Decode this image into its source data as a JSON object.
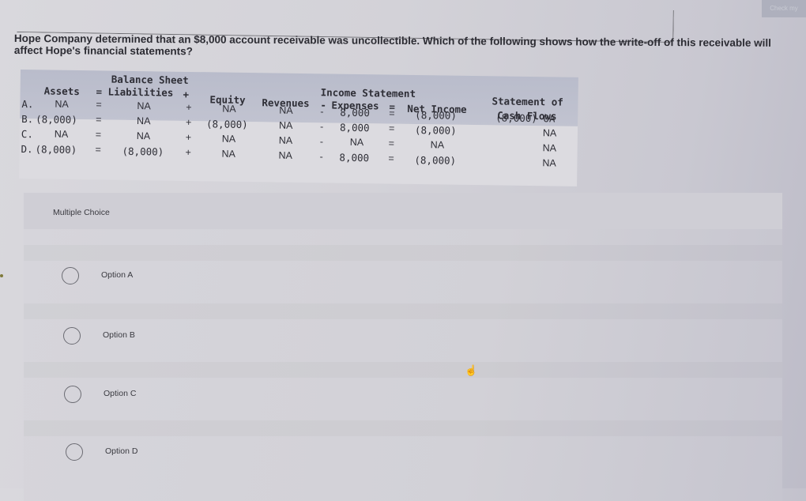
{
  "top_right_button": {
    "label": "Check my"
  },
  "question": {
    "text": "Hope Company determined that an $8,000 account receivable was uncollectible. Which of the following shows how the write-off of this receivable will affect Hope's financial statements?"
  },
  "financial_table": {
    "balance_sheet_title": "Balance Sheet",
    "income_statement_title": "Income Statement",
    "cash_flow_title_line1": "Statement of",
    "cash_flow_title_line2": "Cash Flows",
    "headers": {
      "assets": "Assets",
      "eq1": "=",
      "liabilities": "Liabilities",
      "plus": "+",
      "equity": "Equity",
      "revenues": "Revenues",
      "minus": "-",
      "expenses": "Expenses",
      "eq2": "=",
      "net_income": "Net Income"
    },
    "rows": [
      {
        "letter": "A.",
        "assets": "NA",
        "liabilities": "NA",
        "equity": "NA",
        "revenues": "NA",
        "expenses": "8,000",
        "net_income": "(8,000)",
        "cash_flows": "(8,000) OA"
      },
      {
        "letter": "B.",
        "assets": "(8,000)",
        "liabilities": "NA",
        "equity": "(8,000)",
        "revenues": "NA",
        "expenses": "8,000",
        "net_income": "(8,000)",
        "cash_flows": "NA"
      },
      {
        "letter": "C.",
        "assets": "NA",
        "liabilities": "NA",
        "equity": "NA",
        "revenues": "NA",
        "expenses": "NA",
        "net_income": "NA",
        "cash_flows": "NA"
      },
      {
        "letter": "D.",
        "assets": "(8,000)",
        "liabilities": "(8,000)",
        "equity": "NA",
        "revenues": "NA",
        "expenses": "8,000",
        "net_income": "(8,000)",
        "cash_flows": "NA"
      }
    ],
    "ops": {
      "eq": "=",
      "plus": "+",
      "minus": "-"
    }
  },
  "multiple_choice": {
    "label": "Multiple Choice",
    "options": [
      {
        "label": "Option A",
        "selected": false
      },
      {
        "label": "Option B",
        "selected": false
      },
      {
        "label": "Option C",
        "selected": false
      },
      {
        "label": "Option D",
        "selected": false
      }
    ]
  }
}
